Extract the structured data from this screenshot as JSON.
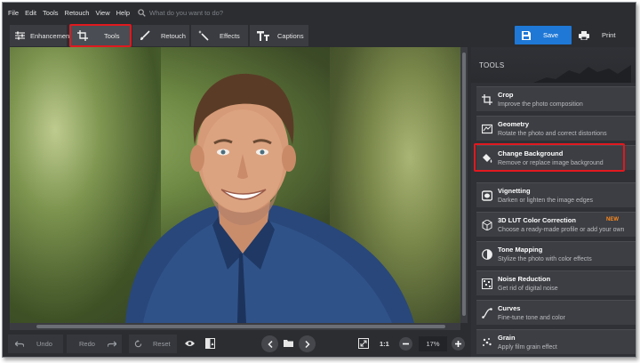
{
  "menu": {
    "items": [
      "File",
      "Edit",
      "Tools",
      "Retouch",
      "View",
      "Help"
    ],
    "search_placeholder": "What do you want to do?"
  },
  "toolbar": {
    "tabs": [
      {
        "label": "Enhancement",
        "icon": "sliders-icon"
      },
      {
        "label": "Tools",
        "icon": "crop-icon",
        "active": true
      },
      {
        "label": "Retouch",
        "icon": "brush-icon"
      },
      {
        "label": "Effects",
        "icon": "magic-wand-icon"
      },
      {
        "label": "Captions",
        "icon": "text-icon"
      }
    ],
    "save_label": "Save",
    "print_label": "Print"
  },
  "bottom": {
    "undo_label": "Undo",
    "redo_label": "Redo",
    "reset_label": "Reset",
    "zoom_ratio_label": "1:1",
    "zoom_value": "17%"
  },
  "panel": {
    "title": "TOOLS",
    "tools": [
      {
        "name": "Crop",
        "desc": "Improve the photo composition",
        "icon": "crop-icon"
      },
      {
        "name": "Geometry",
        "desc": "Rotate the photo and correct distortions",
        "icon": "geometry-icon"
      },
      {
        "name": "Change Background",
        "desc": "Remove or replace image background",
        "icon": "paint-bucket-icon",
        "highlighted": true
      },
      {
        "name": "Vignetting",
        "desc": "Darken or lighten the image edges",
        "icon": "vignette-icon"
      },
      {
        "name": "3D LUT Color Correction",
        "desc": "Choose a ready-made profile or add your own",
        "icon": "lut-cube-icon",
        "badge": "NEW"
      },
      {
        "name": "Tone Mapping",
        "desc": "Stylize the photo with color effects",
        "icon": "tone-mapping-icon"
      },
      {
        "name": "Noise Reduction",
        "desc": "Get rid of digital noise",
        "icon": "noise-icon"
      },
      {
        "name": "Curves",
        "desc": "Fine-tune tone and color",
        "icon": "curves-icon"
      },
      {
        "name": "Grain",
        "desc": "Apply film grain effect",
        "icon": "grain-icon"
      }
    ]
  },
  "colors": {
    "accent": "#1f78d6",
    "highlight": "#e0191f",
    "badge": "#ff8a1f",
    "background": "#2b2d31"
  }
}
